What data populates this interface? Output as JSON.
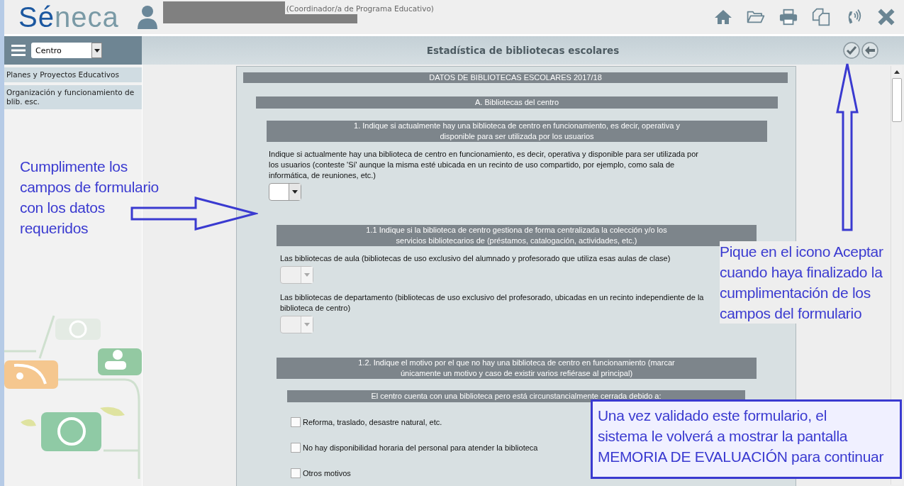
{
  "header": {
    "logo": {
      "first": "Sé",
      "second": "neca"
    },
    "user_role": "(Coordinador/a de Programa Educativo)"
  },
  "sidebar": {
    "dropdown": {
      "value": "Centro"
    },
    "items": [
      {
        "label": "Planes y Proyectos Educativos"
      },
      {
        "label": "Organización y funcionamiento de blib. esc."
      }
    ]
  },
  "page_title": "Estadística de bibliotecas escolares",
  "form": {
    "title": "DATOS DE BIBLIOTECAS ESCOLARES 2017/18",
    "section": "A. Bibliotecas del centro",
    "question": {
      "heading": "1. Indique si actualmente hay una biblioteca de centro en funcionamiento, es decir, operativa y\ndisponible para ser utilizada por los usuarios",
      "fields": [
        {
          "kind": "select",
          "label": "Indique si actualmente hay una biblioteca de centro en funcionamiento, es decir, operativa y disponible para ser utilizada por los usuarios (conteste 'Sí' aunque la misma esté ubicada en un recinto de uso compartido, por ejemplo, como sala de informática, de reuniones, etc.)",
          "disabled": false
        }
      ],
      "subquestions": [
        {
          "heading": "1.1 Indique si la biblioteca de centro gestiona de forma centralizada la colección y/o los\nservicios bibliotecarios de (préstamos, catalogación, actividades, etc.)",
          "fields": [
            {
              "kind": "select",
              "label": "Las bibliotecas de aula (bibliotecas de uso exclusivo del alumnado y profesorado que utiliza esas aulas de clase)",
              "disabled": true
            },
            {
              "kind": "select",
              "label": "Las bibliotecas de departamento (bibliotecas de uso exclusivo del profesorado, ubicadas en un recinto independiente de la biblioteca de centro)",
              "disabled": true
            }
          ]
        },
        {
          "heading": "1.2. Indique el motivo por el que no hay una biblioteca de centro en funcionamiento (marcar\núnicamente un motivo y caso de existir varios refiérase al principal)",
          "group": "El centro cuenta con una biblioteca pero está circunstancialmente cerrada debido a:",
          "fields": [
            {
              "kind": "checkbox",
              "label": "Reforma, traslado, desastre natural, etc.",
              "checked": false
            },
            {
              "kind": "checkbox",
              "label": "No hay disponibilidad horaria del personal para atender la biblioteca",
              "checked": false
            },
            {
              "kind": "checkbox",
              "label": "Otros motivos",
              "checked": false
            }
          ]
        }
      ]
    }
  },
  "annotations": [
    {
      "kind": "note",
      "text": "Cumplimente los\ncampos de formulario\ncon los datos\nrequeridos"
    },
    {
      "kind": "note",
      "text": "Pique en el icono Aceptar\ncuando haya finalizado la\ncumplimentación de los\ncampos del formulario"
    },
    {
      "kind": "boxed_note",
      "text": "Una vez validado este formulario, el\nsistema le volverá a mostrar la pantalla\nMEMORIA DE EVALUACIÓN para continuar"
    }
  ]
}
